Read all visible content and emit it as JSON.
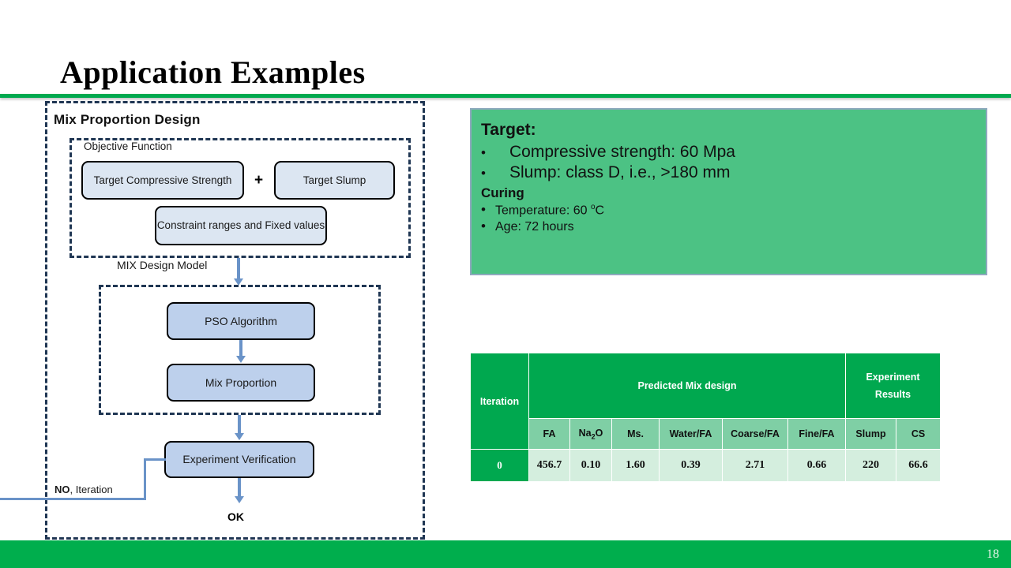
{
  "slide": {
    "title": "Application Examples",
    "page_number": "18",
    "accent_green": "#00A94F",
    "footer_green": "#00AE4D"
  },
  "flowchart": {
    "title": "Mix Proportion Design",
    "objective_function_label": "Objective Function",
    "mix_design_model_label": "MIX Design Model",
    "boxes": {
      "target_compressive_strength": "Target Compressive Strength",
      "target_slump": "Target Slump",
      "plus": "+",
      "constraint": "Constraint ranges and Fixed values",
      "pso": "PSO Algorithm",
      "mix_proportion": "Mix Proportion",
      "experiment_verification": "Experiment Verification"
    },
    "labels": {
      "no_bold": "NO",
      "no_rest": ", Iteration",
      "ok": "OK"
    },
    "colors": {
      "box_light_fill": "#DCE6F2",
      "box_medium_fill": "#BDD0EC",
      "dashed_border": "#1F3653",
      "arrow": "#6A93C8"
    }
  },
  "target_panel": {
    "heading": "Target:",
    "bullets": [
      "Compressive strength: 60 Mpa",
      "Slump: class D, i.e.,  >180 mm"
    ],
    "sub_heading": "Curing",
    "sub_bullets_prefix": [
      "Temperature: 60 ",
      "Age: 72 hours"
    ],
    "temperature_unit": "C",
    "temperature_degree": "o",
    "fill": "#4CC284",
    "border": "#8EA9BD"
  },
  "table": {
    "group_headers": {
      "iteration": "Iteration",
      "predicted": "Predicted Mix design",
      "experiment_line1": "Experiment",
      "experiment_line2": "Results"
    },
    "columns": [
      "FA",
      "Na2O",
      "Ms.",
      "Water/FA",
      "Coarse/FA",
      "Fine/FA",
      "Slump",
      "CS"
    ],
    "column_labels": {
      "fa": "FA",
      "na2o_base": "Na",
      "na2o_sub": "2",
      "na2o_tail": "O",
      "ms": "Ms.",
      "water_fa": "Water/FA",
      "coarse_fa": "Coarse/FA",
      "fine_fa": "Fine/FA",
      "slump": "Slump",
      "cs": "CS"
    },
    "rows": [
      {
        "iteration": "0",
        "fa": "456.7",
        "na2o": "0.10",
        "ms": "1.60",
        "water_fa": "0.39",
        "coarse_fa": "2.71",
        "fine_fa": "0.66",
        "slump": "220",
        "cs": "66.6"
      }
    ],
    "colors": {
      "header_dark": "#00A84F",
      "header_mid": "#7FCFA5",
      "data_cell": "#D4EEDE"
    }
  }
}
